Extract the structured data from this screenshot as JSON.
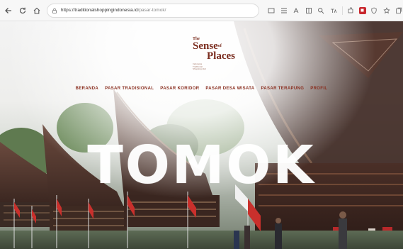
{
  "browser": {
    "url_domain": "https://traditionalshoppingindonesia.id",
    "url_path": "/pasar-tomok/"
  },
  "logo": {
    "the": "The",
    "sense": "Sense",
    "of": "of",
    "places": "Places",
    "tagline": "Indonesia Traditional Shopping Hub"
  },
  "menu": {
    "items": [
      {
        "label": "BERANDA"
      },
      {
        "label": "PASAR TRADISIONAL"
      },
      {
        "label": "PASAR KORIDOR"
      },
      {
        "label": "PASAR DESA WISATA"
      },
      {
        "label": "PASAR TERAPUNG"
      },
      {
        "label": "PROFIL"
      }
    ]
  },
  "hero": {
    "title": "TOMOK"
  },
  "colors": {
    "brand": "#7a2c1e",
    "menu_text": "#8a2f20",
    "title": "#ffffff"
  }
}
